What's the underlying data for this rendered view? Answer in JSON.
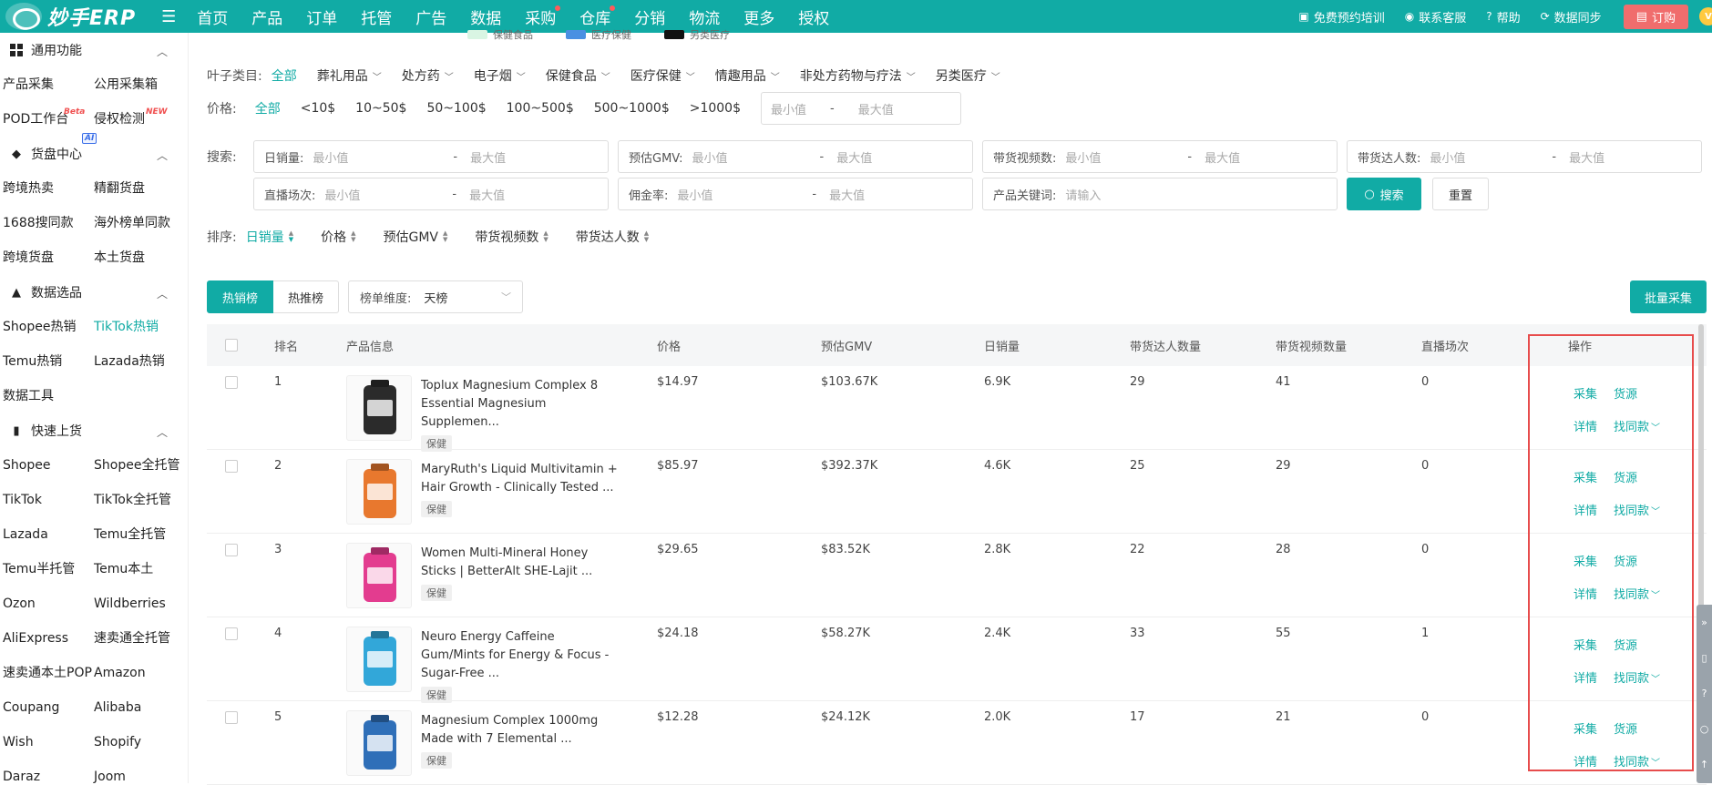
{
  "topbar": {
    "logo_text": "妙手ERP",
    "nav": [
      "首页",
      "产品",
      "订单",
      "托管",
      "广告",
      "数据",
      "采购",
      "仓库",
      "分销",
      "物流",
      "更多",
      "授权"
    ],
    "right": {
      "training": "免费预约培训",
      "support": "联系客服",
      "help": "帮助",
      "sync": "数据同步",
      "order": "订购",
      "avatar": "V"
    }
  },
  "sidebar": {
    "sections": [
      {
        "title": "通用功能",
        "items": [
          "产品采集",
          "公用采集箱",
          "POD工作台",
          "侵权检测"
        ]
      },
      {
        "title": "货盘中心",
        "items": [
          "跨境热卖",
          "精翻货盘",
          "1688搜同款",
          "海外榜单同款",
          "跨境货盘",
          "本土货盘"
        ]
      },
      {
        "title": "数据选品",
        "items": [
          "Shopee热销",
          "TikTok热销",
          "Temu热销",
          "Lazada热销",
          "数据工具"
        ]
      },
      {
        "title": "快速上货",
        "items": [
          "Shopee",
          "Shopee全托管",
          "TikTok",
          "TikTok全托管",
          "Lazada",
          "Temu全托管",
          "Temu半托管",
          "Temu本土",
          "Ozon",
          "Wildberries",
          "AliExpress",
          "速卖通全托管",
          "速卖通本土POP",
          "Amazon",
          "Coupang",
          "Alibaba",
          "Wish",
          "Shopify",
          "Daraz",
          "Joom"
        ]
      }
    ],
    "tags": {
      "beta": "Beta",
      "new": "NEW",
      "ai": "AI"
    }
  },
  "legend_strip": [
    "保健食品",
    "医疗保健",
    "另类医疗"
  ],
  "colors": {
    "accent": "#11aba5",
    "highlight": "#e74c4c",
    "order_btn": "#f06d6d"
  },
  "filters": {
    "category_label": "叶子类目:",
    "categories": [
      "全部",
      "葬礼用品",
      "处方药",
      "电子烟",
      "保健食品",
      "医疗保健",
      "情趣用品",
      "非处方药物与疗法",
      "另类医疗"
    ],
    "price_label": "价格:",
    "price_options": [
      "全部",
      "<10$",
      "10~50$",
      "50~100$",
      "100~500$",
      "500~1000$",
      ">1000$"
    ],
    "min_ph": "最小值",
    "max_ph": "最大值",
    "dash": "-"
  },
  "search": {
    "label": "搜索:",
    "fields_row1": [
      "日销量:",
      "预估GMV:",
      "带货视频数:",
      "带货达人数:"
    ],
    "fields_row2": [
      "直播场次:",
      "佣金率:"
    ],
    "keyword_label": "产品关键词:",
    "keyword_ph": "请输入",
    "search_btn": "搜索",
    "reset_btn": "重置"
  },
  "sort": {
    "label": "排序:",
    "items": [
      "日销量",
      "价格",
      "预估GMV",
      "带货视频数",
      "带货达人数"
    ]
  },
  "tabs": {
    "hot_sales": "热销榜",
    "hot_recommend": "热推榜",
    "dimension_label": "榜单维度:",
    "dimension_value": "天榜",
    "batch_btn": "批量采集"
  },
  "table": {
    "headers": [
      "排名",
      "产品信息",
      "价格",
      "预估GMV",
      "日销量",
      "带货达人数量",
      "带货视频数量",
      "直播场次",
      "操作"
    ],
    "ops": {
      "collect": "采集",
      "source": "货源",
      "detail": "详情",
      "similar": "找同款"
    },
    "rows": [
      {
        "rank": "1",
        "title": "Toplux Magnesium Complex 8 Essential Magnesium Supplemen...",
        "tag": "保健",
        "price": "$14.97",
        "gmv": "$103.67K",
        "daily": "6.9K",
        "creators": "29",
        "videos": "41",
        "live": "0",
        "img": "#2b2b2b"
      },
      {
        "rank": "2",
        "title": "MaryRuth's Liquid Multivitamin + Hair Growth - Clinically Tested ...",
        "tag": "保健",
        "price": "$85.97",
        "gmv": "$392.37K",
        "daily": "4.6K",
        "creators": "25",
        "videos": "29",
        "live": "0",
        "img": "#e8782e"
      },
      {
        "rank": "3",
        "title": "Women Multi-Mineral Honey Sticks | BetterAlt SHE-Lajit ...",
        "tag": "保健",
        "price": "$29.65",
        "gmv": "$83.52K",
        "daily": "2.8K",
        "creators": "22",
        "videos": "28",
        "live": "0",
        "img": "#e33c8f"
      },
      {
        "rank": "4",
        "title": "Neuro Energy Caffeine Gum/Mints for Energy & Focus - Sugar-Free ...",
        "tag": "保健",
        "price": "$24.18",
        "gmv": "$58.27K",
        "daily": "2.4K",
        "creators": "33",
        "videos": "55",
        "live": "1",
        "img": "#32a7d9"
      },
      {
        "rank": "5",
        "title": "Magnesium Complex 1000mg Made with 7 Elemental ...",
        "tag": "保健",
        "price": "$12.28",
        "gmv": "$24.12K",
        "daily": "2.0K",
        "creators": "17",
        "videos": "21",
        "live": "0",
        "img": "#2f6fb8"
      }
    ]
  }
}
